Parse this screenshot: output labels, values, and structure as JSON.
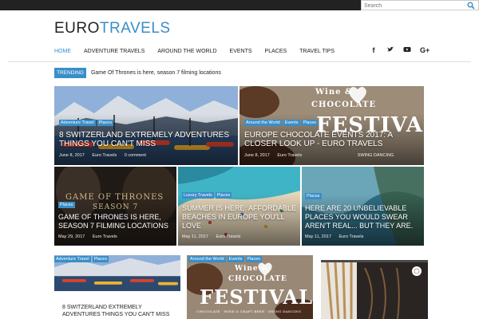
{
  "search": {
    "placeholder": "Search"
  },
  "logo": {
    "part1": "EURO",
    "part2": "TRAVELS"
  },
  "nav": [
    "HOME",
    "ADVENTURE TRAVELS",
    "AROUND THE WORLD",
    "EVENTS",
    "PLACES",
    "TRAVEL TIPS"
  ],
  "social_icons": [
    "facebook-icon",
    "twitter-icon",
    "youtube-icon",
    "google-plus-icon"
  ],
  "trending": {
    "label": "TRENDING",
    "text": "Game Of Thrones is here, season 7 filming locations"
  },
  "featured": [
    {
      "tags": [
        "Adventure Travel",
        "Places"
      ],
      "title": "8 Switzerland Extremely Adventures Things You Can't Miss",
      "date": "June 8, 2017",
      "author": "Euro Travels",
      "comments": "0 comment"
    },
    {
      "tags": [
        "Around the World",
        "Events",
        "Places"
      ],
      "title": "Europe Chocolate Events 2017: A Closer Look Up - Euro Travels",
      "date": "June 8, 2017",
      "author": "Euro Travels",
      "overlay_line1": "Wine &",
      "overlay_line2": "CHOCOLATE",
      "overlay_big": "FESTIVAL",
      "overlay_sub": "SWING DANCING"
    },
    {
      "tags": [
        "Places"
      ],
      "title": "Game Of Thrones Is Here, Season 7 Filming Locations",
      "date": "May 29, 2017",
      "author": "Euro Travels",
      "overlay_line1": "GAME OF THRONES",
      "overlay_line2": "SEASON 7"
    },
    {
      "tags": [
        "Luxury Travels",
        "Places"
      ],
      "title": "Summer Is Here: Affordable Beaches In Europe You'll Love",
      "date": "May 11, 2017",
      "author": "Euro Travels"
    },
    {
      "tags": [
        "Places"
      ],
      "title": "Here Are 20 Unbelievable Places You Would Swear Aren't Real... But They Are.",
      "date": "May 11, 2017",
      "author": "Euro Travels"
    }
  ],
  "cards": [
    {
      "tags": [
        "Adventure Travel",
        "Places"
      ],
      "title": "8 Switzerland Extremely Adventures Things You Can't Miss"
    },
    {
      "tags": [
        "Around the World",
        "Events",
        "Places"
      ],
      "overlay_line1": "Wine &",
      "overlay_line2": "CHOCOLATE",
      "overlay_big": "FESTIVAL",
      "overlay_sub": "CHOCOLATE · WINE & CRAFT BEER · SWING DANCING"
    },
    {
      "tags": []
    }
  ],
  "colors": {
    "accent": "#3a8ec8",
    "topbar": "#222222"
  }
}
